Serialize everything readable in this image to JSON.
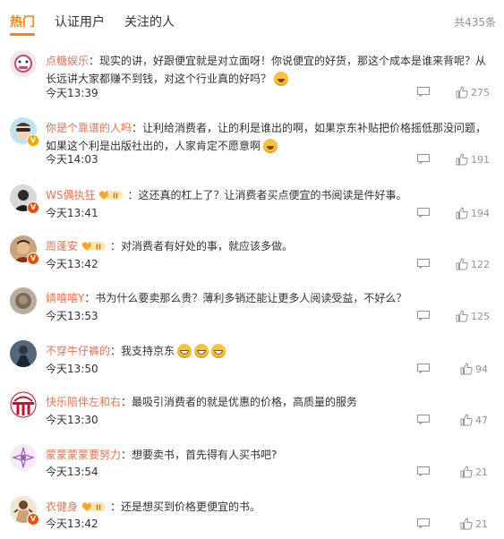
{
  "tabs": [
    {
      "label": "热门",
      "active": true
    },
    {
      "label": "认证用户",
      "active": false
    },
    {
      "label": "关注的人",
      "active": false
    }
  ],
  "total": "共435条",
  "colors": {
    "accent": "#ff8200",
    "username": "#eb7350",
    "muted": "#939393"
  },
  "comments": [
    {
      "user": "点糖娱乐",
      "text": "：现实的讲，好跟便宜就是对立面呀！你说便宜的好货，那这个成本是谁来背呢？从长远讲大家都赚不到钱，对这个行业真的好吗？",
      "time": "今天13:39",
      "likes": "275",
      "emoji": "laughing-tears",
      "medal": false
    },
    {
      "user": "你是个靠谱的人吗",
      "text": "：让利给消费者，让的利是谁出的啊，如果京东补贴把价格摇低那没问题，如果这个利是出版社出的，人家肯定不愿意啊",
      "time": "今天14:03",
      "likes": "191",
      "emoji": "laughing-tears",
      "medal": false
    },
    {
      "user": "WS偶执狂",
      "text": "：这还真的杠上了？让消费者买点便宜的书阅读是件好事。",
      "time": "今天13:41",
      "likes": "194",
      "emoji": "",
      "medal": true,
      "medal_level": "II"
    },
    {
      "user": "周蓬安",
      "text": "：对消费者有好处的事，就应该多做。",
      "time": "今天13:42",
      "likes": "122",
      "emoji": "",
      "medal": true,
      "medal_level": "II"
    },
    {
      "user": "婧嘻嘻Y",
      "text": "：书为什么要卖那么贵？薄利多销还能让更多人阅读受益，不好么？",
      "time": "今天13:53",
      "likes": "125",
      "emoji": "",
      "medal": false
    },
    {
      "user": "不穿牛仔裤的",
      "text": "：我支持京东",
      "time": "今天13:50",
      "likes": "94",
      "emoji": "grin-x3",
      "medal": false
    },
    {
      "user": "快乐陪伴左和右",
      "text": "：最吸引消费者的就是优惠的价格，高质量的服务",
      "time": "今天13:30",
      "likes": "47",
      "emoji": "",
      "medal": false
    },
    {
      "user": "蒙蒙蒙蒙要努力",
      "text": "：想要卖书，首先得有人买书吧?",
      "time": "今天13:54",
      "likes": "21",
      "emoji": "",
      "medal": false
    },
    {
      "user": "衣健身",
      "text": "：还是想买到价格更便宜的书。",
      "time": "今天13:42",
      "likes": "21",
      "emoji": "",
      "medal": true,
      "medal_level": "II"
    }
  ]
}
